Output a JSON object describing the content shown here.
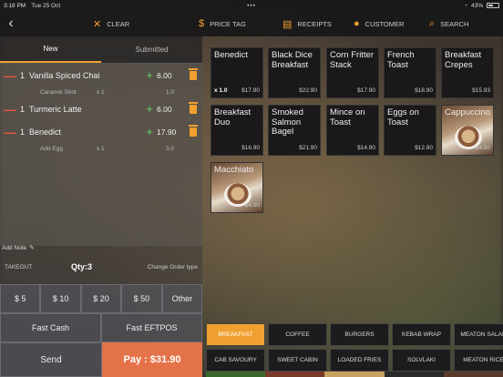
{
  "status_bar": {
    "time": "3:18 PM",
    "date": "Tue 25 Oct",
    "dots": "•••",
    "battery": "43%"
  },
  "toolbar": {
    "clear": "CLEAR",
    "price_tag": "PRICE TAG",
    "receipts": "RECEIPTS",
    "customer": "CUSTOMER",
    "search": "SEARCH"
  },
  "tabs": {
    "new": "New",
    "submitted": "Submitted"
  },
  "order_lines": [
    {
      "qty": "1",
      "name": "Vanilla Spiced Chai",
      "price": "6.00",
      "modifier": {
        "name": "Caramel Shot",
        "qty": "x 1",
        "price": "1.0"
      }
    },
    {
      "qty": "1",
      "name": "Turmeric Latte",
      "price": "6.00"
    },
    {
      "qty": "1",
      "name": "Benedict",
      "price": "17.90",
      "modifier": {
        "name": "Add Egg",
        "qty": "x 1",
        "price": "3.0"
      }
    }
  ],
  "note": {
    "label": "Add Note"
  },
  "summary": {
    "order_type": "TAKEOUT",
    "qty": "Qty:3",
    "change_type": "Change Order type"
  },
  "cash_buttons": [
    "$ 5",
    "$ 10",
    "$ 20",
    "$ 50",
    "Other"
  ],
  "fast_buttons": [
    "Fast Cash",
    "Fast EFTPOS"
  ],
  "send": "Send",
  "pay": "Pay : $31.90",
  "products": [
    {
      "name": "Benedict",
      "price": "$17.90",
      "count": "x 1.0"
    },
    {
      "name": "Black Dice Breakfast",
      "price": "$22.90"
    },
    {
      "name": "Corn Fritter Stack",
      "price": "$17.90"
    },
    {
      "name": "French Toast",
      "price": "$18.90"
    },
    {
      "name": "Breakfast Crepes",
      "price": "$15.93"
    },
    {
      "name": "Breakfast Duo",
      "price": "$16.90"
    },
    {
      "name": "Smoked Salmon Bagel",
      "price": "$21.90"
    },
    {
      "name": "Mince on Toast",
      "price": "$14.90"
    },
    {
      "name": "Eggs on Toast",
      "price": "$12.90"
    },
    {
      "name": "Cappuccino",
      "price": "$4.50"
    },
    {
      "name": "Macchiato",
      "price": "$4.00"
    }
  ],
  "categories_row1": [
    "BREAKFAST",
    "COFFEE",
    "BURGERS",
    "KEBAB WRAP",
    "MEATON SALAD"
  ],
  "categories_row2": [
    "CAB SAVOURY",
    "SWEET CABIN",
    "LOADED FRIES",
    "SOLVLAKI",
    "MEATON RICE"
  ],
  "colors": {
    "accent": "#f0a030",
    "pay": "#e4734a",
    "minus": "#e05a3a",
    "plus": "#6ad06a"
  }
}
